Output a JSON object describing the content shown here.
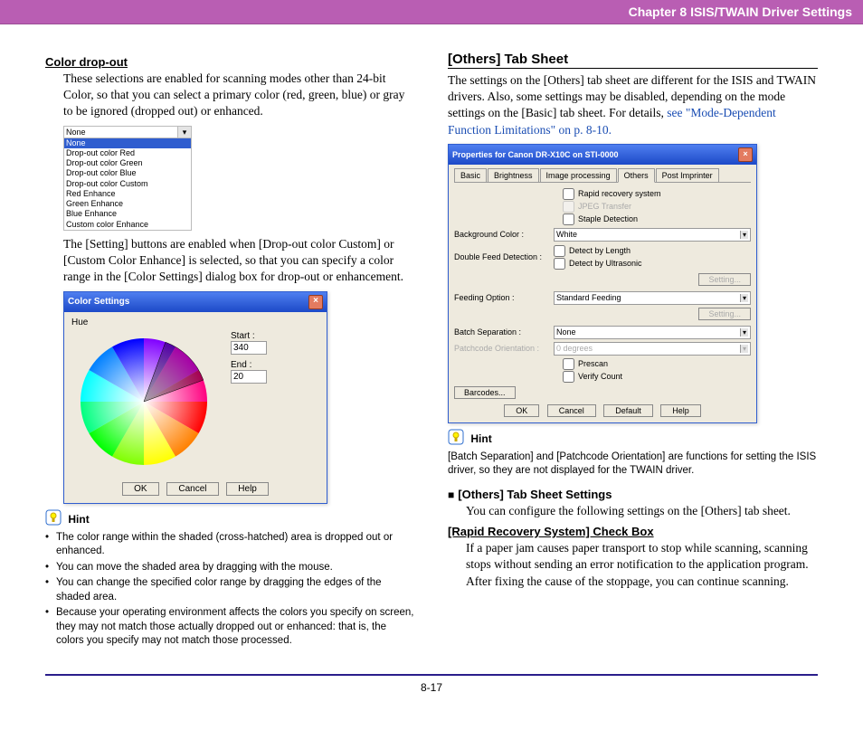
{
  "header": {
    "chapter": "Chapter 8   ISIS/TWAIN Driver Settings"
  },
  "left": {
    "color_dropout_title": "Color drop-out",
    "color_dropout_desc": "These selections are enabled for scanning modes other than 24-bit Color, so that you can select a primary color (red, green, blue) or gray to be ignored (dropped out) or enhanced.",
    "dropdown": {
      "selected": "None",
      "options": [
        "None",
        "Drop-out color Red",
        "Drop-out color Green",
        "Drop-out color Blue",
        "Drop-out color Custom",
        "Red Enhance",
        "Green Enhance",
        "Blue Enhance",
        "Custom color Enhance"
      ]
    },
    "setting_desc": "The [Setting] buttons are enabled when [Drop-out color Custom] or [Custom Color Enhance] is selected, so that you can specify a color range in the [Color Settings] dialog box for drop-out or enhancement.",
    "color_dlg": {
      "title": "Color Settings",
      "hue_label": "Hue",
      "start_label": "Start :",
      "start_value": "340",
      "end_label": "End :",
      "end_value": "20",
      "ok": "OK",
      "cancel": "Cancel",
      "help": "Help"
    },
    "hint_label": "Hint",
    "hints": [
      "The color range within the shaded (cross-hatched) area is dropped out or enhanced.",
      "You can move the shaded area by dragging with the mouse.",
      "You can change the specified color range by dragging the edges of the shaded area.",
      "Because your operating environment affects the colors you specify on screen, they may not match those actually dropped out or enhanced: that is, the colors you specify may not match those processed."
    ]
  },
  "right": {
    "others_title": "[Others] Tab Sheet",
    "others_desc_a": "The settings on the [Others] tab sheet are different for the ISIS and TWAIN drivers. Also, some settings may be disabled, depending on the mode settings on the [Basic] tab sheet. For details, ",
    "others_link": "see \"Mode-Dependent Function Limitations\" on p. 8-10.",
    "prop_dlg": {
      "title": "Properties for Canon DR-X10C on STI-0000",
      "tabs": [
        "Basic",
        "Brightness",
        "Image processing",
        "Others",
        "Post Imprinter"
      ],
      "chk_rapid": "Rapid recovery system",
      "chk_jpeg": "JPEG Transfer",
      "chk_staple": "Staple Detection",
      "bg_label": "Background Color :",
      "bg_value": "White",
      "dfd_label": "Double Feed Detection :",
      "dfd_len": "Detect by Length",
      "dfd_us": "Detect by Ultrasonic",
      "setting_btn": "Setting...",
      "feed_label": "Feeding Option :",
      "feed_value": "Standard Feeding",
      "batch_label": "Batch Separation :",
      "batch_value": "None",
      "patch_label": "Patchcode Orientation :",
      "patch_value": "0 degrees",
      "prescan": "Prescan",
      "verify": "Verify Count",
      "barcodes": "Barcodes...",
      "ok": "OK",
      "cancel": "Cancel",
      "default": "Default",
      "help": "Help"
    },
    "hint_label": "Hint",
    "hint_text": "[Batch Separation] and [Patchcode Orientation] are functions for setting the ISIS driver, so they are not displayed for the TWAIN driver.",
    "settings_heading": "[Others] Tab Sheet Settings",
    "settings_desc": "You can configure the following settings on the [Others] tab sheet.",
    "rapid_title": "[Rapid Recovery System] Check Box",
    "rapid_desc": "If a paper jam causes paper transport to stop while scanning, scanning stops without sending an error notification to the application program. After fixing the cause of the stoppage, you can continue scanning."
  },
  "footer": {
    "page_number": "8-17"
  }
}
